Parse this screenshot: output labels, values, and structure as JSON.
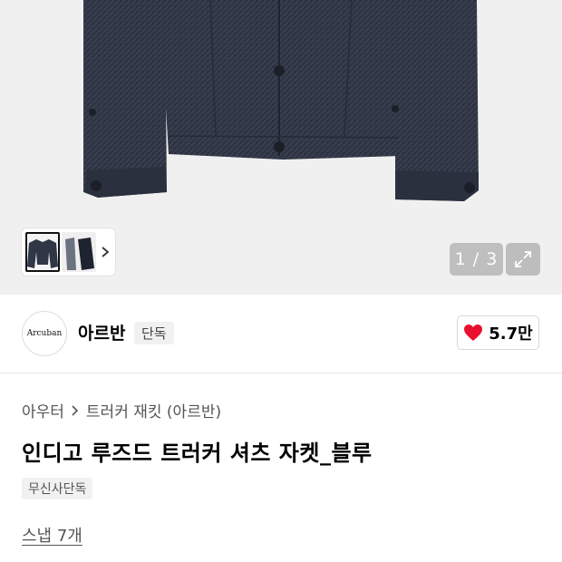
{
  "gallery": {
    "page_counter": "1 / 3",
    "current_page": 1,
    "total_pages": 3,
    "expand_icon": "expand-icon",
    "next_icon": "chevron-right-icon"
  },
  "brand": {
    "logo_text": "Arcuban",
    "name": "아르반",
    "exclusive_tag": "단독"
  },
  "like": {
    "count": "5.7만",
    "icon": "heart-icon",
    "color": "#e8102c"
  },
  "breadcrumb": {
    "category": "아우터",
    "subcategory": "트러커 재킷 (아르반)"
  },
  "product": {
    "title": "인디고 루즈드 트러커 셔츠 자켓_블루",
    "badge": "무신사단독",
    "snap_link": "스냅 7개"
  },
  "colors": {
    "hero_bg": "#f0f0f0",
    "jacket_navy": "#2e3442"
  }
}
